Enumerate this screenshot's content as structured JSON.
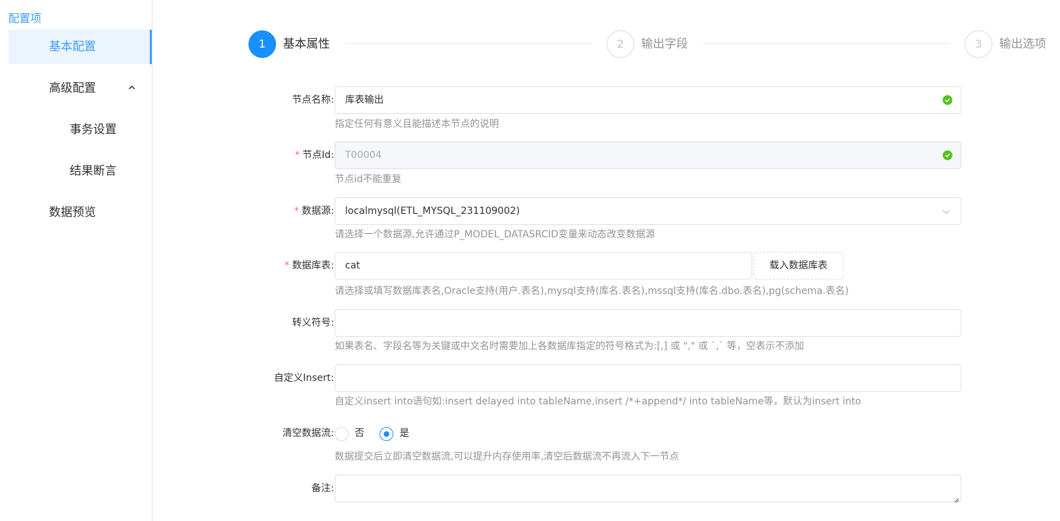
{
  "sidebar": {
    "title": "配置项",
    "items": [
      {
        "label": "基本配置"
      },
      {
        "label": "高级配置"
      },
      {
        "label": "事务设置"
      },
      {
        "label": "结果断言"
      },
      {
        "label": "数据预览"
      }
    ]
  },
  "steps": [
    {
      "number": "1",
      "label": "基本属性",
      "status": "active"
    },
    {
      "number": "2",
      "label": "输出字段",
      "status": "wait"
    },
    {
      "number": "3",
      "label": "输出选项",
      "status": "wait"
    }
  ],
  "colors": {
    "primary": "#1890ff",
    "success": "#52c41a",
    "required": "#f56c6c"
  },
  "form": {
    "node_name": {
      "label": "节点名称:",
      "value": "库表输出",
      "hint": "指定任何有意义且能描述本节点的说明"
    },
    "node_id": {
      "label": "节点Id:",
      "value": "T00004",
      "hint": "节点id不能重复"
    },
    "datasource": {
      "label": "数据源:",
      "value": "localmysql(ETL_MYSQL_231109002)",
      "hint": "请选择一个数据源,允许通过P_MODEL_DATASRCID变量来动态改变数据源"
    },
    "table": {
      "label": "数据库表:",
      "value": "cat",
      "button": "载入数据库表",
      "hint": "请选择或填写数据库表名,Oracle支持(用户.表名),mysql支持(库名.表名),mssql支持(库名.dbo.表名),pg(schema.表名)"
    },
    "escape": {
      "label": "转义符号:",
      "value": "",
      "hint": "如果表名、字段名等为关键或中文名时需要加上各数据库指定的符号格式为:[,] 或 \",\" 或 `,` 等，空表示不添加"
    },
    "custom_insert": {
      "label": "自定义Insert:",
      "value": "",
      "hint": "自定义insert into语句如:insert delayed into tableName,insert /*+append*/ into tableName等，默认为insert into"
    },
    "clear_stream": {
      "label": "清空数据流:",
      "options": [
        "否",
        "是"
      ],
      "selected": "是",
      "hint": "数据提交后立即清空数据流,可以提升内存使用率,清空后数据流不再流入下一节点"
    },
    "remark": {
      "label": "备注:",
      "value": ""
    }
  }
}
